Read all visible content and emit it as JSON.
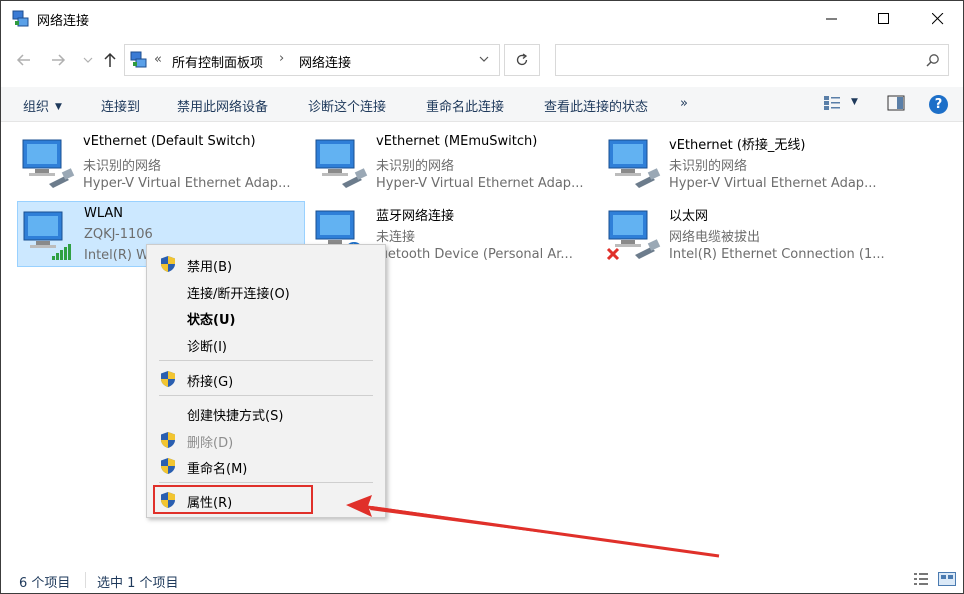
{
  "window": {
    "title": "网络连接",
    "minimize_icon": "minimize-icon",
    "maximize_icon": "maximize-icon",
    "close_icon": "close-icon"
  },
  "address_bar": {
    "overflow": "«",
    "crumbs": [
      "所有控制面板项",
      "网络连接"
    ],
    "separator": "›"
  },
  "search": {
    "placeholder": ""
  },
  "commands": {
    "organize": "组织",
    "connect": "连接到",
    "disable": "禁用此网络设备",
    "diagnose": "诊断这个连接",
    "rename": "重命名此连接",
    "view_status": "查看此连接的状态",
    "more": "»",
    "help": "?"
  },
  "connections": [
    {
      "name": "vEthernet (Default Switch)",
      "status": "未识别的网络",
      "device": "Hyper-V Virtual Ethernet Adap...",
      "icon": "ethernet-adapter-icon"
    },
    {
      "name": "vEthernet (MEmuSwitch)",
      "status": "未识别的网络",
      "device": "Hyper-V Virtual Ethernet Adap...",
      "icon": "ethernet-adapter-icon"
    },
    {
      "name": "vEthernet (桥接_无线)",
      "status": "未识别的网络",
      "device": "Hyper-V Virtual Ethernet Adap...",
      "icon": "ethernet-adapter-icon"
    },
    {
      "name": "WLAN",
      "status": "ZQKJ-1106",
      "device": "Intel(R) W",
      "icon": "wifi-adapter-icon",
      "selected": true
    },
    {
      "name": "蓝牙网络连接",
      "status": "未连接",
      "device": "luetooth Device (Personal Ar...",
      "icon": "bluetooth-adapter-icon"
    },
    {
      "name": "以太网",
      "status": "网络电缆被拔出",
      "device": "Intel(R) Ethernet Connection (1...",
      "icon": "ethernet-disconnected-icon"
    }
  ],
  "context_menu": {
    "items": [
      {
        "label": "禁用(B)",
        "shield": true
      },
      {
        "label": "连接/断开连接(O)",
        "shield": false
      },
      {
        "label": "状态(U)",
        "shield": false,
        "bold": true
      },
      {
        "label": "诊断(I)",
        "shield": false
      },
      {
        "label": "桥接(G)",
        "shield": true
      },
      {
        "label": "创建快捷方式(S)",
        "shield": false
      },
      {
        "label": "删除(D)",
        "shield": true,
        "disabled": true
      },
      {
        "label": "重命名(M)",
        "shield": true
      },
      {
        "label": "属性(R)",
        "shield": true,
        "highlighted": true
      }
    ]
  },
  "status_bar": {
    "count": "6 个项目",
    "selected": "选中 1 个项目"
  },
  "colors": {
    "accent": "#1d6fc8",
    "selection": "#cce8ff",
    "annotation": "#e0302a"
  }
}
